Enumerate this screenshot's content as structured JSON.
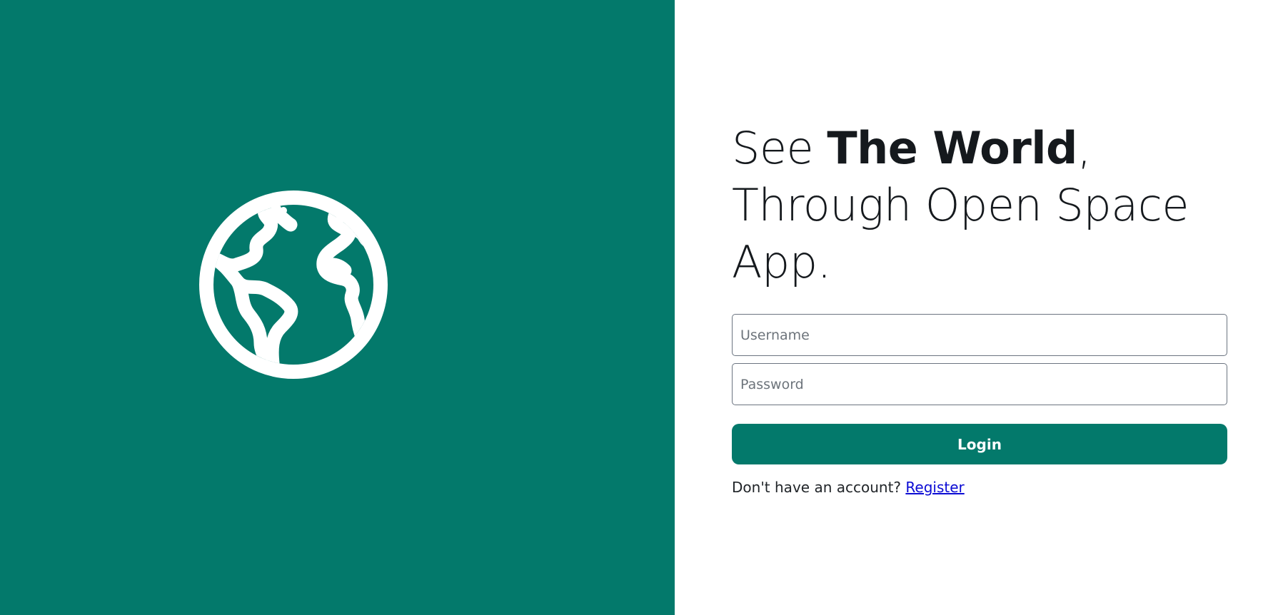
{
  "colors": {
    "brand": "#03796b",
    "link": "#0b0bd4",
    "text": "#15191d"
  },
  "left_panel": {
    "icon": "globe-icon"
  },
  "headline": {
    "pre": "See ",
    "bold": "The World",
    "comma": ",",
    "line2": "Through Open Space",
    "line3": "App."
  },
  "form": {
    "username_placeholder": "Username",
    "username_value": "",
    "password_placeholder": "Password",
    "password_value": "",
    "login_label": "Login"
  },
  "register": {
    "prompt": "Don't have an account? ",
    "link_label": "Register"
  }
}
